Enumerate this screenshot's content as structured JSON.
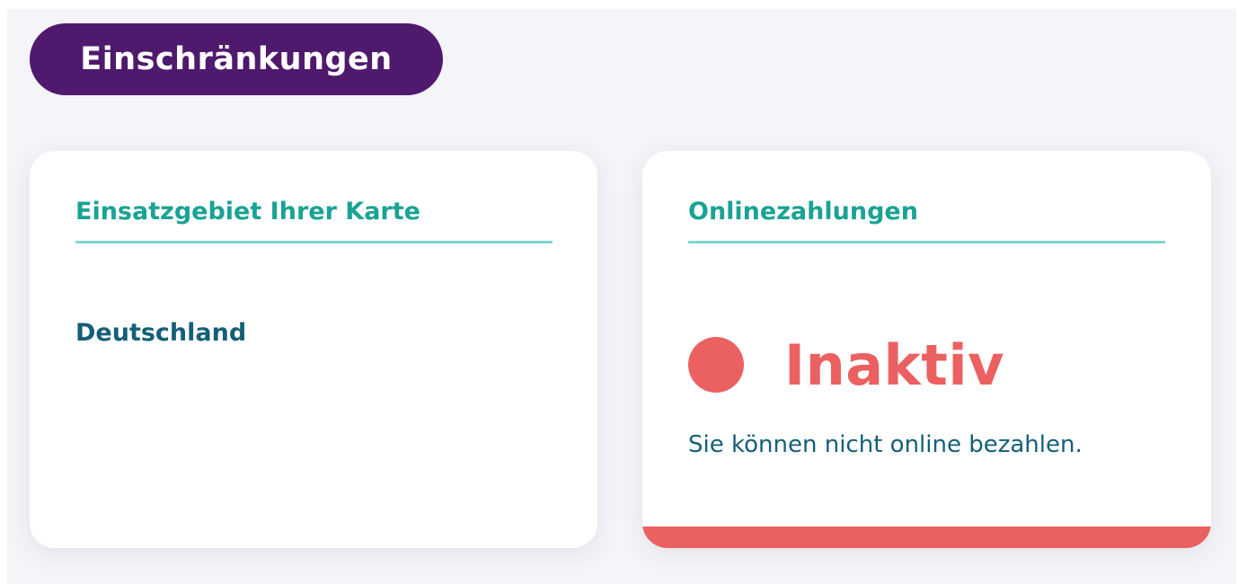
{
  "section": {
    "title": "Einschränkungen"
  },
  "region_card": {
    "title": "Einsatzgebiet Ihrer Karte",
    "value": "Deutschland"
  },
  "online_card": {
    "title": "Onlinezahlungen",
    "status": "Inaktiv",
    "description": "Sie können nicht online bezahlen."
  },
  "colors": {
    "pill_bg": "#4f1a6e",
    "title_teal": "#1aa394",
    "rule_teal": "#7fd6cf",
    "value_blue": "#145f78",
    "inactive_red": "#eb6060"
  },
  "icons": {
    "status_indicator": "status-dot-icon"
  }
}
